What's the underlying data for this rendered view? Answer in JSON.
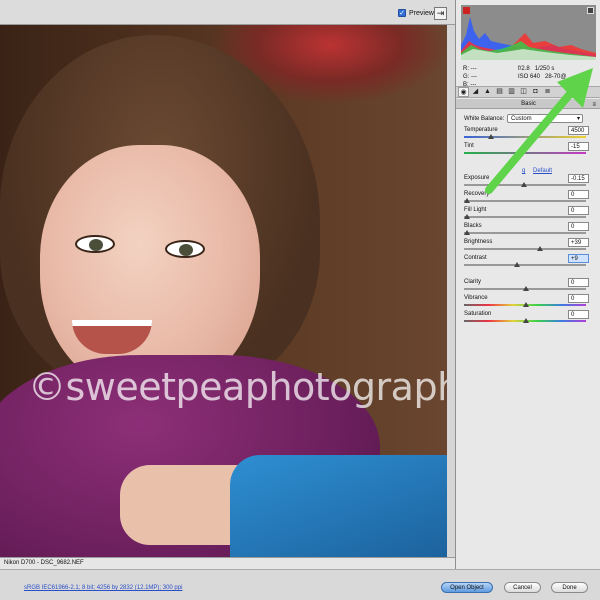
{
  "toolbar": {
    "preview_label": "Preview",
    "preview_checked": true
  },
  "photo": {
    "watermark_text": "sweetpeaphotography"
  },
  "camera_info": "Nikon D700  -  DSC_9682.NEF",
  "bottom": {
    "workflow_link": "sRGB IEC61966-2.1; 8 bit; 4256 by 2832 (12.1MP); 300 ppi",
    "open_label": "Open Object",
    "cancel_label": "Cancel",
    "done_label": "Done"
  },
  "readout": {
    "r_label": "R:",
    "g_label": "G:",
    "b_label": "B:",
    "r": "---",
    "g": "---",
    "b": "---",
    "aperture": "f/2.8",
    "shutter": "1/250 s",
    "iso": "ISO 640",
    "focal": "28-70@"
  },
  "panel": {
    "section_title": "Basic",
    "white_balance_label": "White Balance:",
    "white_balance_value": "Custom",
    "auto_partial": "g",
    "default_link": "Default",
    "sliders": [
      {
        "label": "Temperature",
        "value": "4500",
        "pos": 0.2
      },
      {
        "label": "Tint",
        "value": "-15",
        "pos": 0.45
      },
      {
        "label": "Exposure",
        "value": "-0.15",
        "pos": 0.48
      },
      {
        "label": "Recovery",
        "value": "0",
        "pos": 0.0
      },
      {
        "label": "Fill Light",
        "value": "0",
        "pos": 0.0
      },
      {
        "label": "Blacks",
        "value": "0",
        "pos": 0.0
      },
      {
        "label": "Brightness",
        "value": "+39",
        "pos": 0.62
      },
      {
        "label": "Contrast",
        "value": "+9",
        "pos": 0.42
      },
      {
        "label": "Clarity",
        "value": "0",
        "pos": 0.5
      },
      {
        "label": "Vibrance",
        "value": "0",
        "pos": 0.5
      },
      {
        "label": "Saturation",
        "value": "0",
        "pos": 0.5
      }
    ]
  },
  "colors": {
    "arrow": "#5fd34a",
    "accent": "#2f6fd6"
  }
}
